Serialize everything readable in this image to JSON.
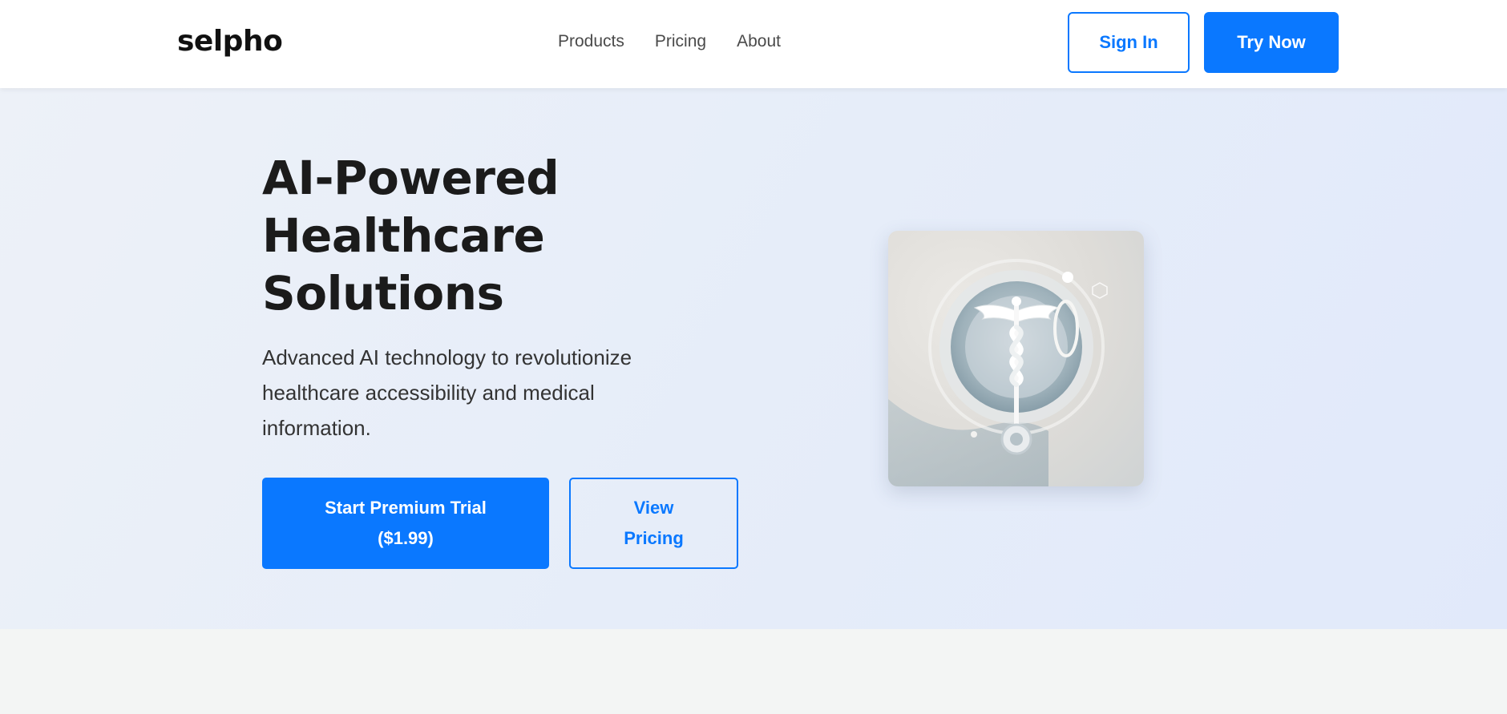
{
  "brand": {
    "logo_text": "selpho"
  },
  "nav": {
    "items": [
      {
        "label": "Products"
      },
      {
        "label": "Pricing"
      },
      {
        "label": "About"
      }
    ]
  },
  "header_actions": {
    "sign_in": "Sign In",
    "try_now": "Try Now"
  },
  "hero": {
    "headline_lines": [
      "AI-Powered",
      "Healthcare",
      "Solutions"
    ],
    "subtext": "Advanced AI technology to revolutionize healthcare accessibility and medical information.",
    "primary_cta_line1": "Start Premium Trial",
    "primary_cta_line2": "($1.99)",
    "secondary_cta_line1": "View",
    "secondary_cta_line2": "Pricing",
    "image_icon": "caduceus-stethoscope-icon"
  },
  "colors": {
    "accent": "#0a78ff",
    "header_bg": "#ffffff",
    "hero_bg": "#e6edf9",
    "page_bg": "#f3f5f4",
    "heading": "#1b1b1b"
  }
}
